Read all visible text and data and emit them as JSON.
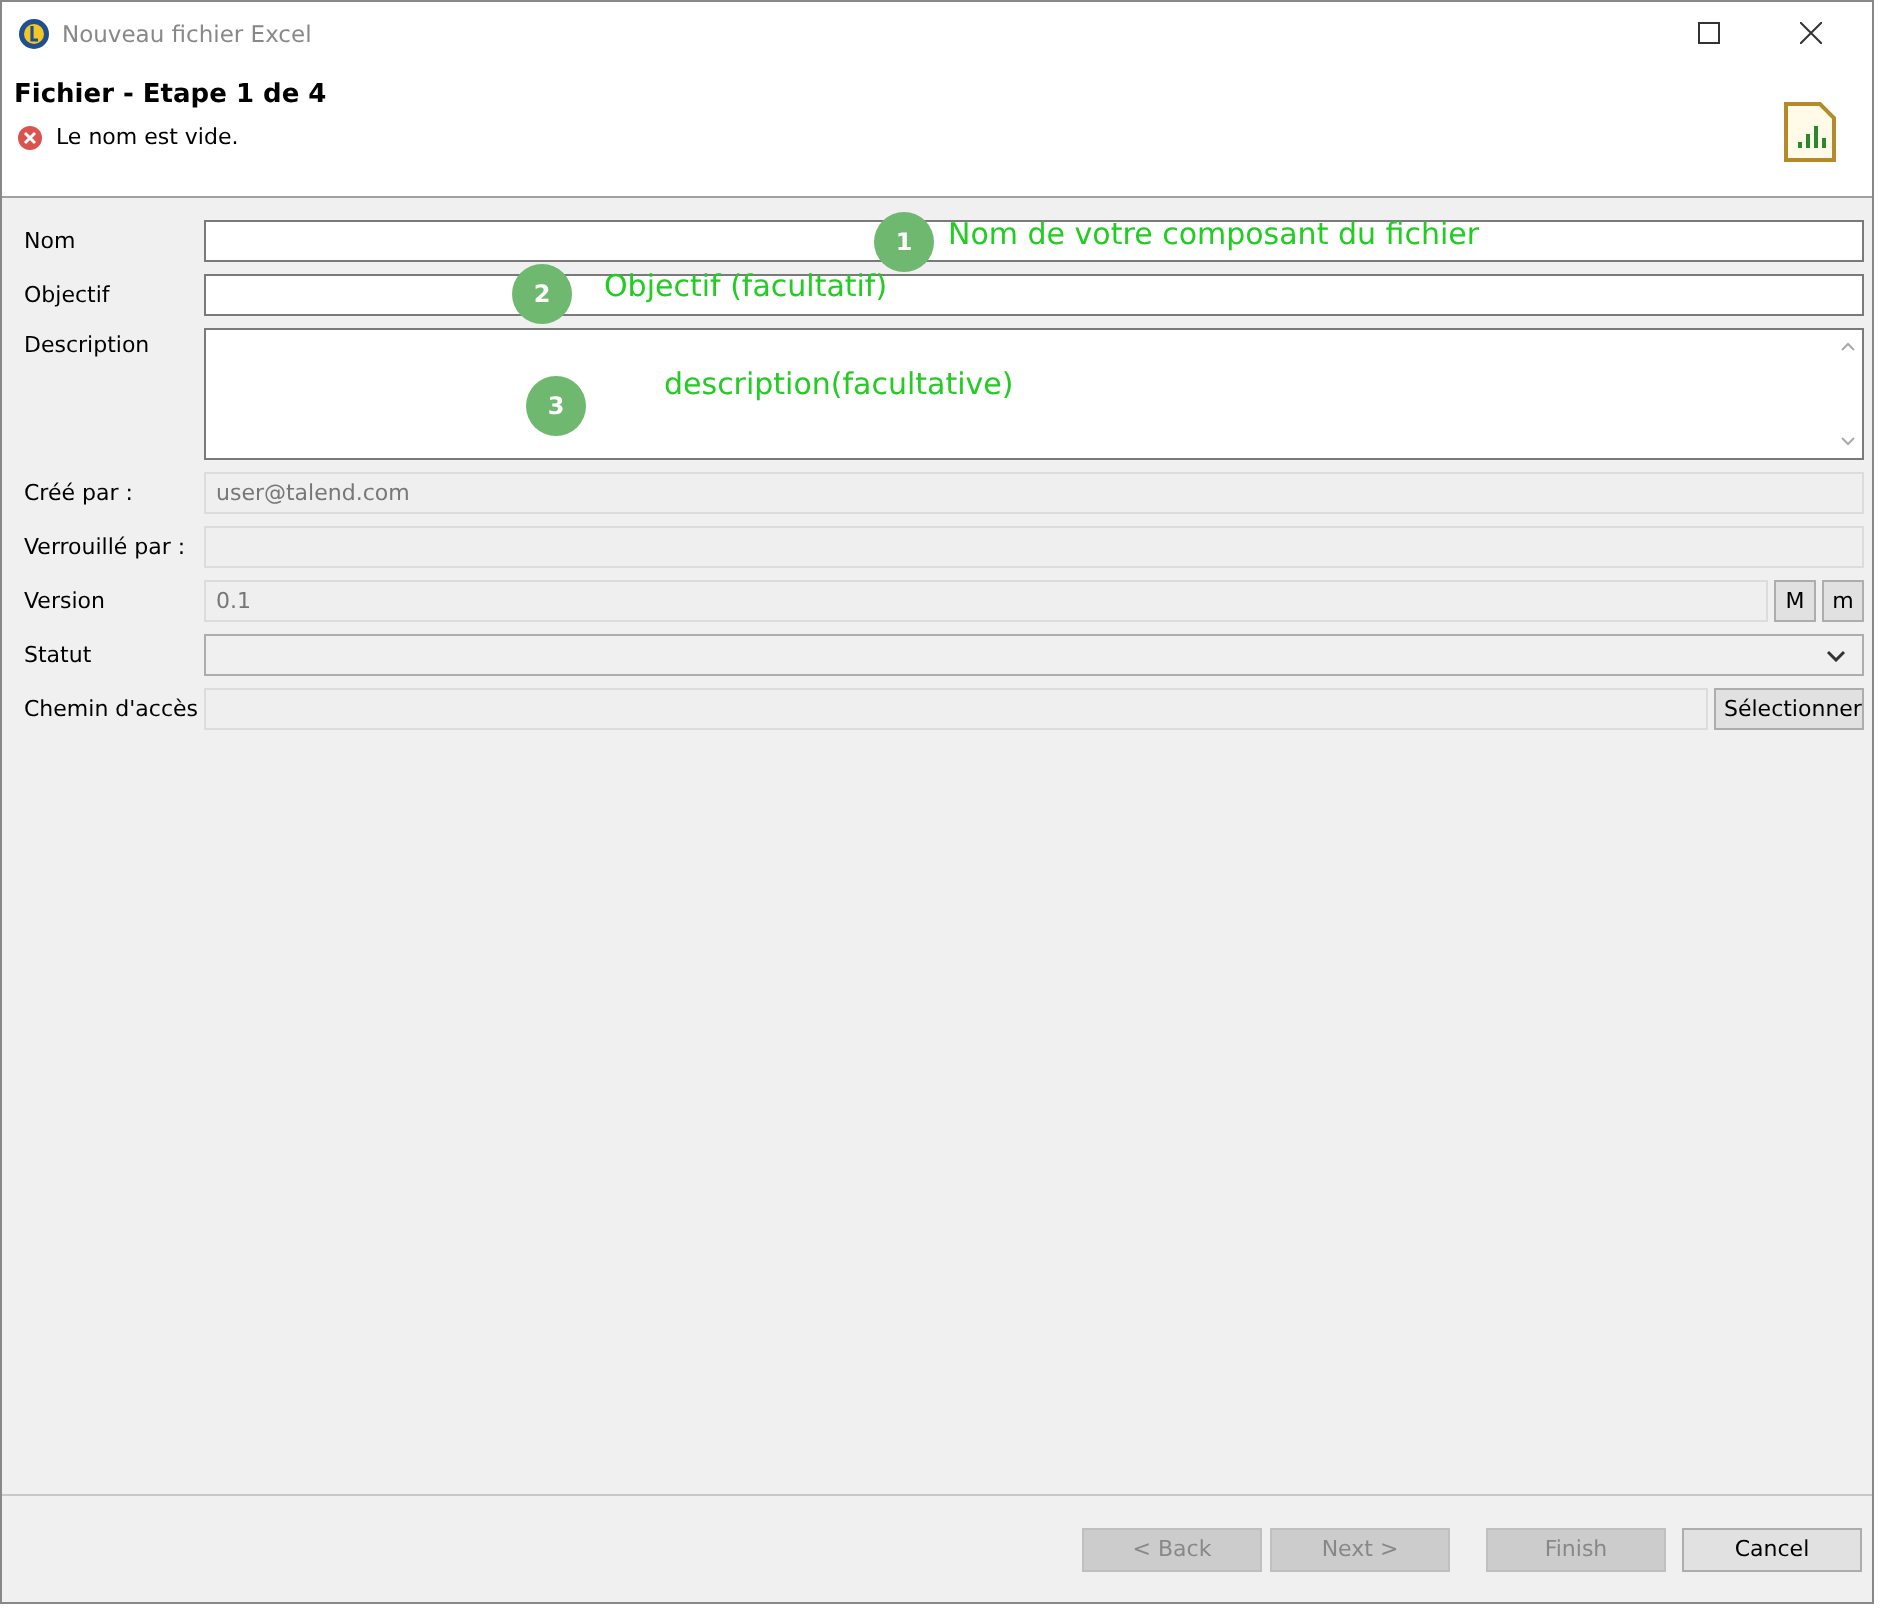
{
  "window": {
    "title": "Nouveau fichier Excel"
  },
  "header": {
    "title": "Fichier - Etape 1 de 4",
    "error": "Le nom est vide."
  },
  "fields": [
    {
      "label": "Nom",
      "kind": "text",
      "disabled": false
    },
    {
      "label": "Objectif",
      "kind": "text",
      "disabled": false
    },
    {
      "label": "Description",
      "kind": "textarea",
      "disabled": false
    },
    {
      "label": "Créé par :",
      "kind": "text",
      "disabled": true,
      "value": "user@talend.com"
    },
    {
      "label": "Verrouillé par :",
      "kind": "text",
      "disabled": true
    },
    {
      "label": "Version",
      "kind": "version",
      "disabled": true,
      "value": "0.1",
      "buttons": [
        "M",
        "m"
      ]
    },
    {
      "label": "Statut",
      "kind": "combo",
      "disabled": false
    },
    {
      "label": "Chemin d'accès",
      "kind": "path",
      "disabled": true,
      "button": "Sélectionner"
    }
  ],
  "annotations": [
    {
      "number": "1",
      "text": "Nom de votre composant du fichier"
    },
    {
      "number": "2",
      "text": "Objectif (facultatif)"
    },
    {
      "number": "3",
      "text": "description(facultative)"
    }
  ],
  "buttons": [
    {
      "label": "< Back",
      "disabled": true
    },
    {
      "label": "Next >",
      "disabled": true
    },
    {
      "label": "Finish",
      "disabled": true
    },
    {
      "label": "Cancel",
      "disabled": false
    }
  ]
}
